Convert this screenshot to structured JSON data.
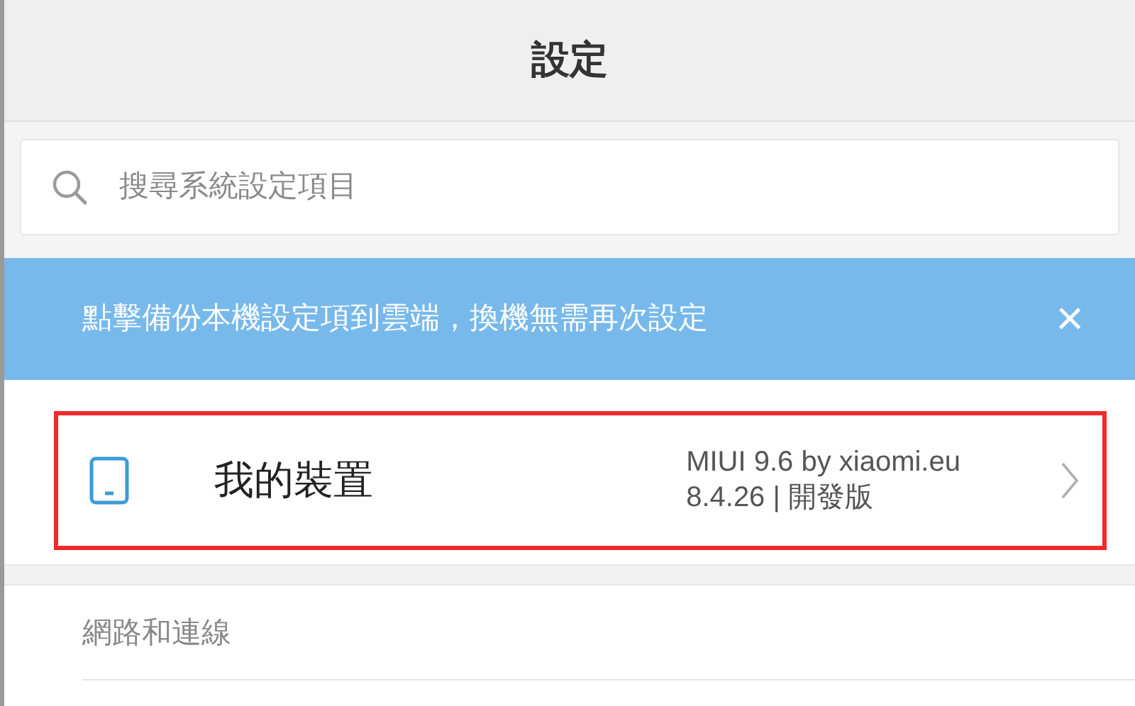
{
  "header": {
    "title": "設定"
  },
  "search": {
    "placeholder": "搜尋系統設定項目"
  },
  "banner": {
    "text": "點擊備份本機設定項到雲端，換機無需再次設定",
    "close": "×"
  },
  "device": {
    "label": "我的裝置",
    "detail_lines": [
      "MIUI 9.6 by xiaomi.eu",
      "8.4.26 | 開發版"
    ],
    "highlighted": true
  },
  "sections": [
    {
      "title": "網路和連線"
    }
  ]
}
